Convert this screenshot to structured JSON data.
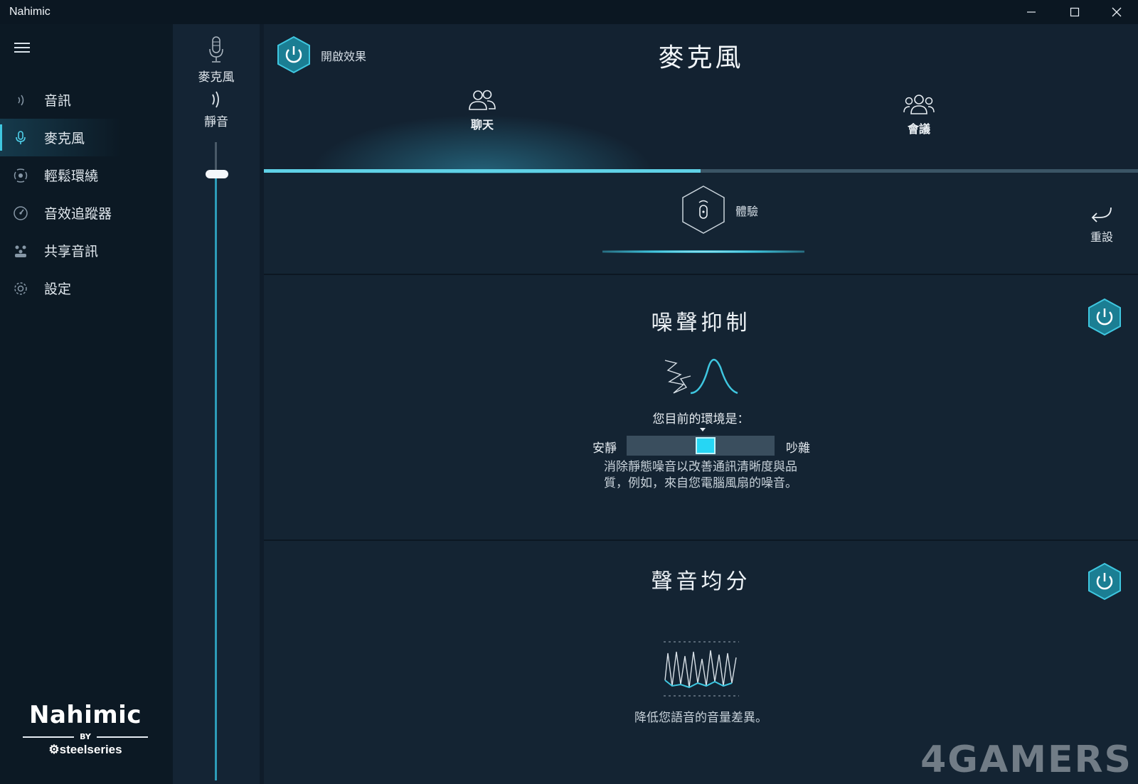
{
  "window": {
    "title": "Nahimic",
    "minimize": "—",
    "maximize": "☐",
    "close": "✕"
  },
  "sidebar": {
    "items": [
      {
        "label": "音訊",
        "icon": "audio-waves-icon"
      },
      {
        "label": "麥克風",
        "icon": "microphone-icon"
      },
      {
        "label": "輕鬆環繞",
        "icon": "surround-icon"
      },
      {
        "label": "音效追蹤器",
        "icon": "sound-tracker-icon"
      },
      {
        "label": "共享音訊",
        "icon": "share-audio-icon"
      },
      {
        "label": "設定",
        "icon": "gear-icon"
      }
    ],
    "active_index": 1,
    "brand": {
      "logo": "Nahimic",
      "by": "BY",
      "company": "steelseries"
    }
  },
  "volume": {
    "mic_label": "麥克風",
    "mute_label": "靜音",
    "level_percent": 95
  },
  "main": {
    "enable_label": "開啟效果",
    "title": "麥克風",
    "tabs": [
      {
        "label": "聊天",
        "active": true
      },
      {
        "label": "會議",
        "active": false
      }
    ],
    "experience_label": "體驗",
    "reset_label": "重設",
    "noise": {
      "title": "噪聲抑制",
      "env_label": "您目前的環境是：",
      "left_label": "安靜",
      "right_label": "吵雜",
      "level_percent": 55,
      "desc_line1": "消除靜態噪音以改善通訊清晰度與品",
      "desc_line2": "質，例如，來自您電腦風扇的噪音。"
    },
    "leveler": {
      "title": "聲音均分",
      "desc": "降低您語音的音量差異。"
    }
  },
  "watermark": "4GAMERS",
  "colors": {
    "accent": "#3fc7e0",
    "background": "#132231",
    "sidebar": "#0c1924"
  }
}
